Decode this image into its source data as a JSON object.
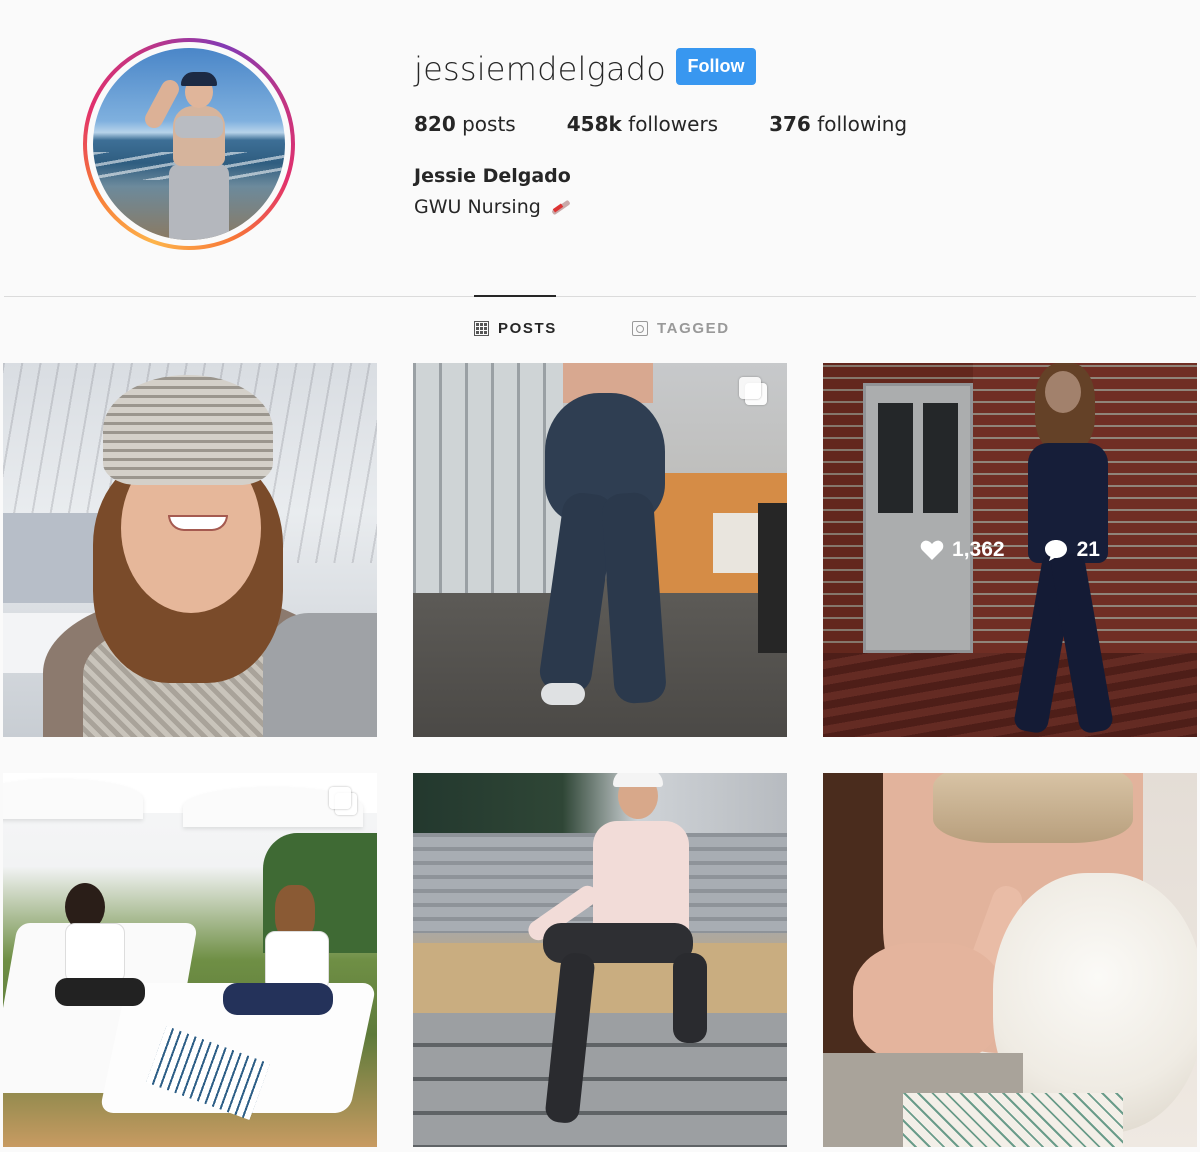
{
  "profile": {
    "username": "jessiemdelgado",
    "follow_label": "Follow",
    "stats": {
      "posts_count": "820",
      "posts_label": "posts",
      "followers_count": "458k",
      "followers_label": "followers",
      "following_count": "376",
      "following_label": "following"
    },
    "full_name": "Jessie Delgado",
    "bio": "GWU Nursing",
    "bio_emoji": "syringe"
  },
  "tabs": [
    {
      "label": "POSTS",
      "icon": "grid-icon",
      "active": true
    },
    {
      "label": "TAGGED",
      "icon": "tag-icon",
      "active": false
    }
  ],
  "posts": [
    {
      "id": 1,
      "desc": "selfie-snow-beanie",
      "multi": false
    },
    {
      "id": 2,
      "desc": "gym-leggings",
      "multi": true
    },
    {
      "id": 3,
      "desc": "scrubs-brick-wall",
      "multi": false,
      "hover": {
        "likes": "1,362",
        "comments": "21"
      }
    },
    {
      "id": 4,
      "desc": "poolside-loungers",
      "multi": true
    },
    {
      "id": 5,
      "desc": "stairs-sitting",
      "multi": false
    },
    {
      "id": 6,
      "desc": "sleep-mask-dog",
      "multi": false
    }
  ],
  "colors": {
    "accent": "#3897f0",
    "text": "#262626",
    "muted": "#999999",
    "background": "#fafafa"
  }
}
